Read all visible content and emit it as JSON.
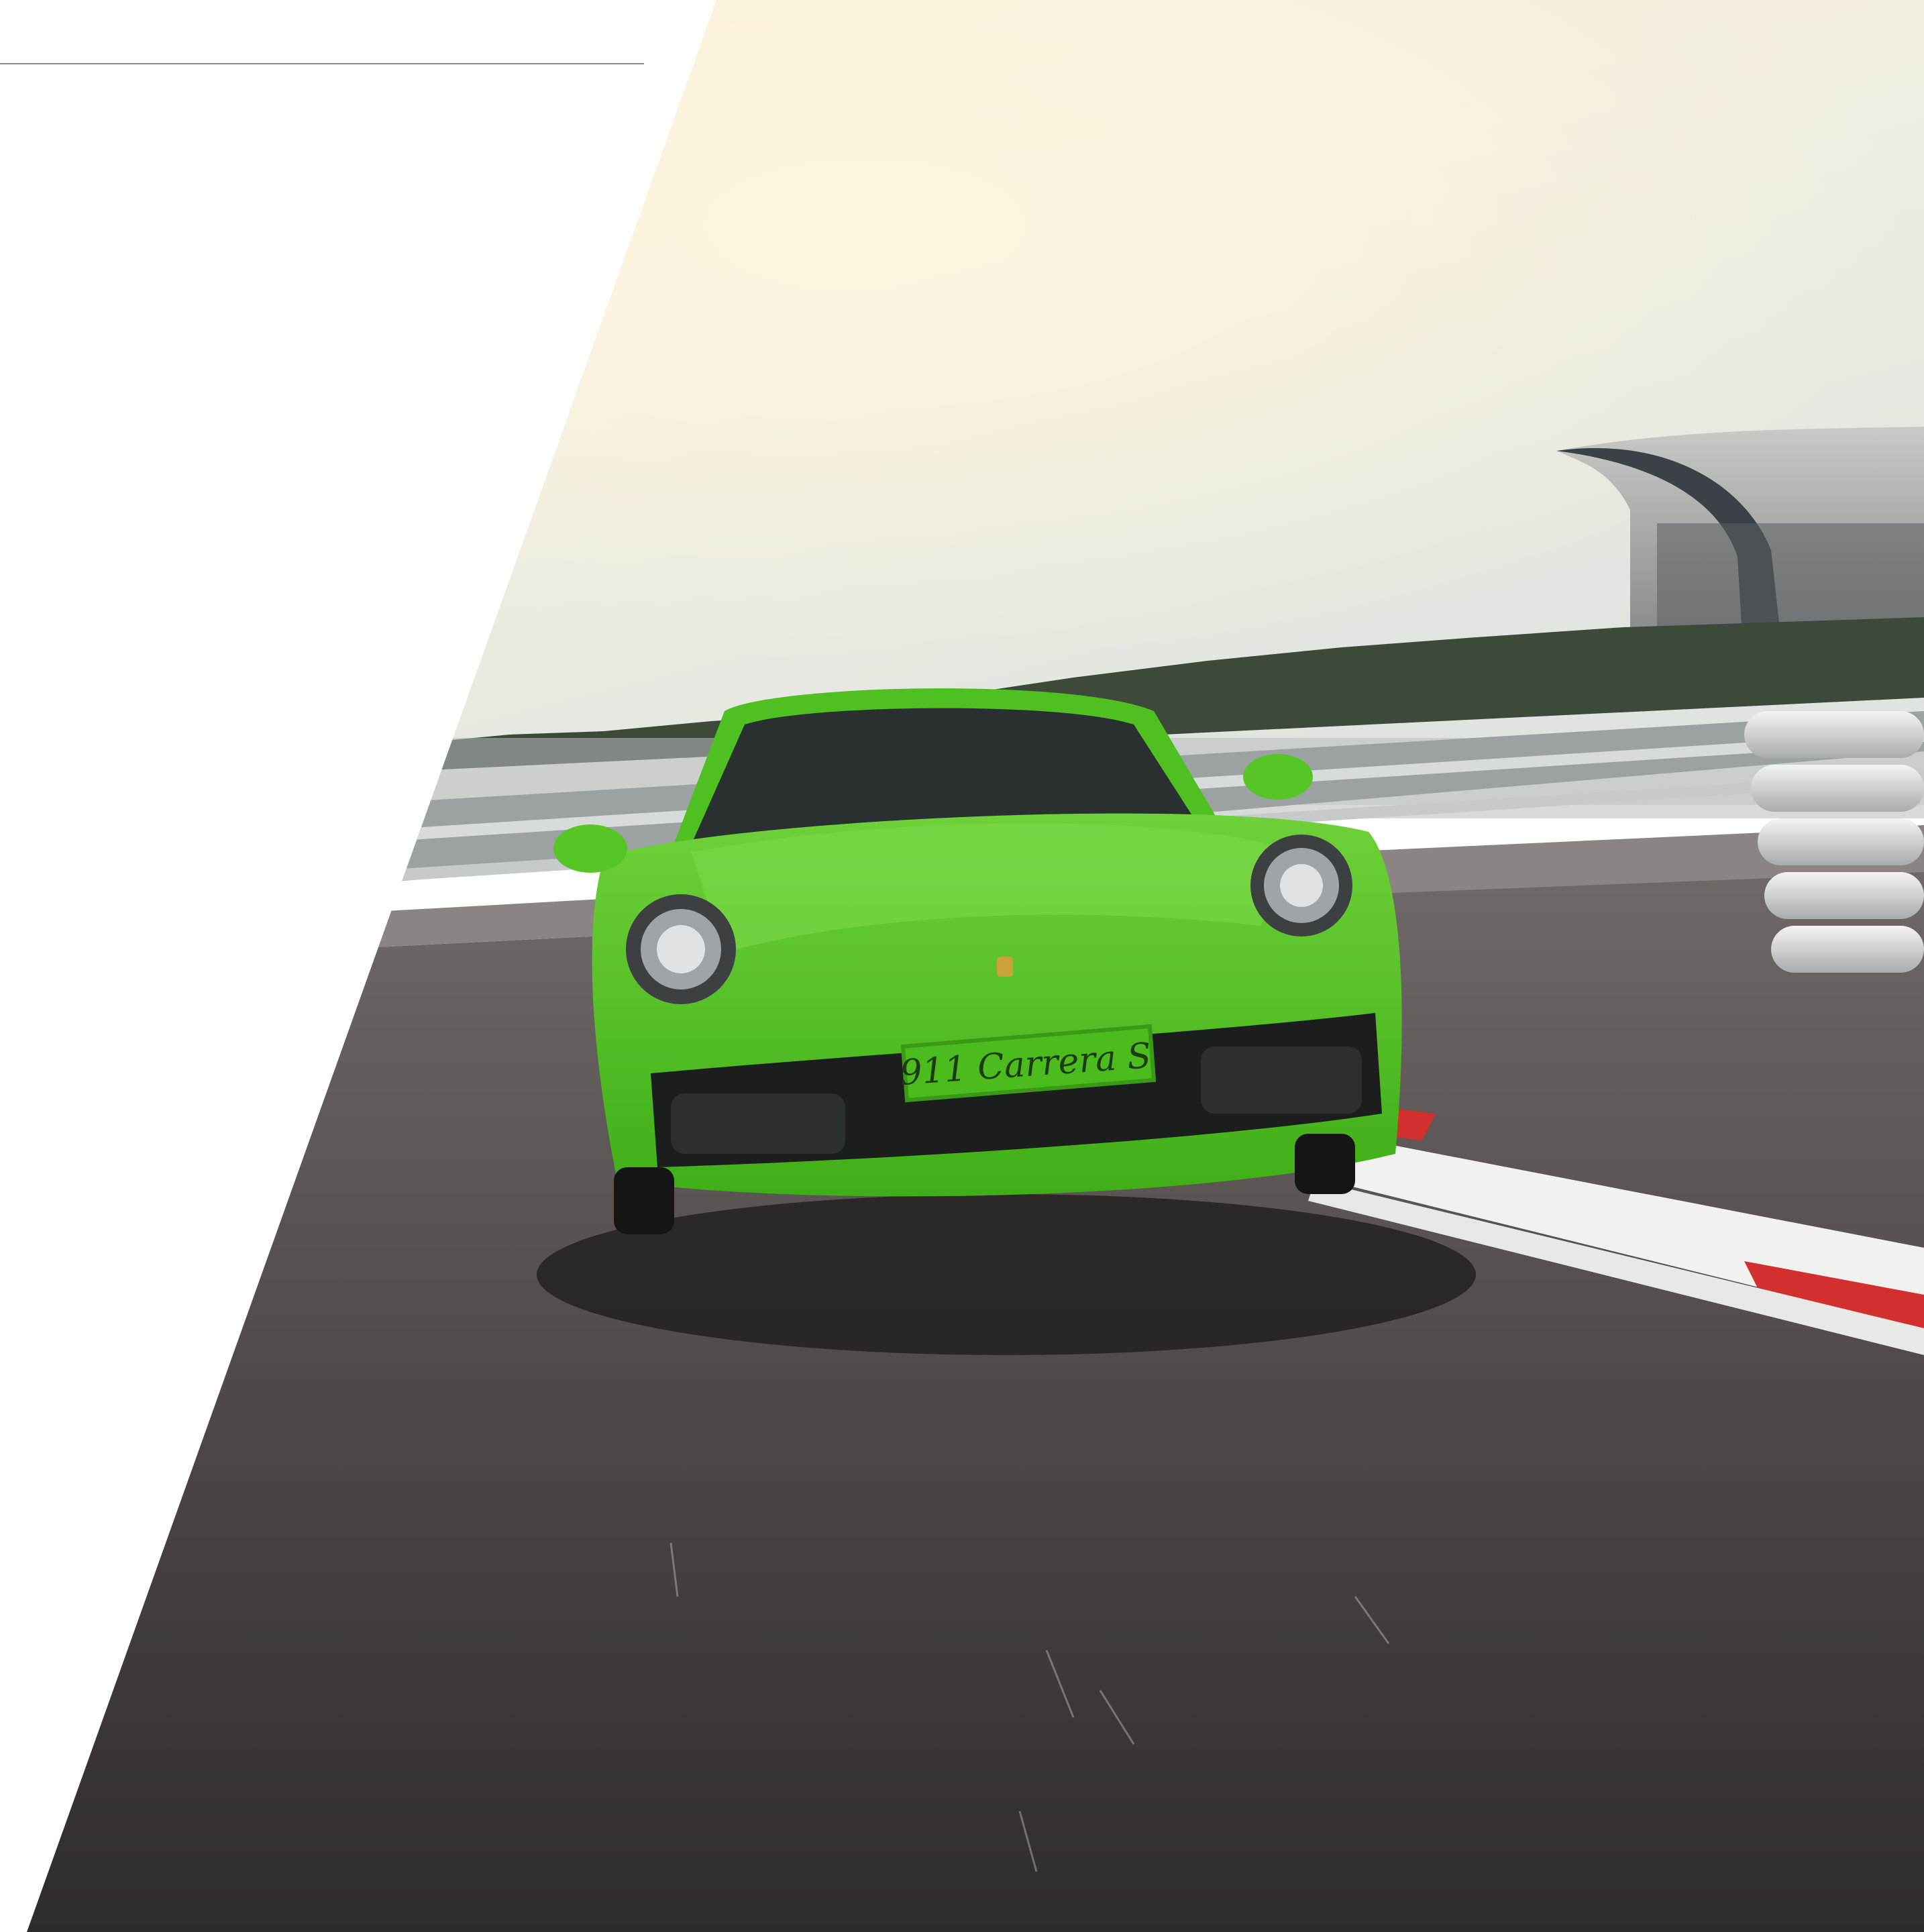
{
  "hero": {
    "plate_text": "911 Carrera S",
    "colors": {
      "background": "#ffffff",
      "divider": "#8a8a8a",
      "car_body": "#4fc21f",
      "sky": "#f6eed8",
      "asphalt": "#4a4644",
      "curb_red": "#d2302f",
      "curb_white": "#f2f2f2",
      "grass": "#8a7a4a"
    }
  }
}
